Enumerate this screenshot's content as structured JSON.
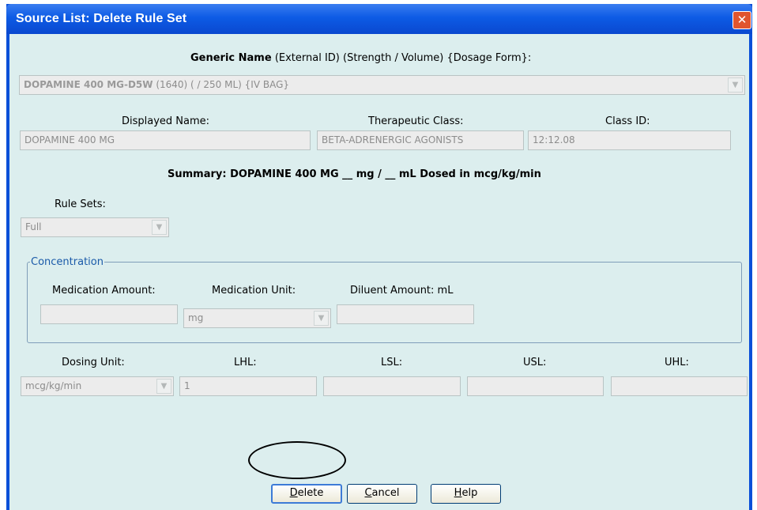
{
  "window": {
    "title": "Source List:  Delete Rule Set",
    "close_glyph": "✕"
  },
  "header": {
    "generic_name_bold": "Generic Name",
    "generic_name_rest": " (External ID) (Strength / Volume) {Dosage Form}:"
  },
  "generic_select": {
    "name": "DOPAMINE 400 MG-D5W",
    "details": " (1640) ( / 250 ML) {IV BAG}"
  },
  "drug_fields": {
    "displayed_name_label": "Displayed Name:",
    "displayed_name_value": "DOPAMINE 400 MG",
    "therapeutic_class_label": "Therapeutic Class:",
    "therapeutic_class_value": "BETA-ADRENERGIC AGONISTS",
    "class_id_label": "Class ID:",
    "class_id_value": "12:12.08"
  },
  "summary": "Summary:  DOPAMINE 400 MG __ mg / __ mL Dosed in mcg/kg/min",
  "rule_sets": {
    "label": "Rule Sets:",
    "selected": "Full"
  },
  "concentration": {
    "group_title": "Concentration",
    "medication_amount_label": "Medication Amount:",
    "medication_amount_value": "",
    "medication_unit_label": "Medication Unit:",
    "medication_unit_selected": "mg",
    "diluent_amount_label": "Diluent Amount: mL",
    "diluent_amount_value": ""
  },
  "limits": {
    "dosing_unit_label": "Dosing Unit:",
    "dosing_unit_selected": "mcg/kg/min",
    "lhl_label": "LHL:",
    "lhl_value": "1",
    "lsl_label": "LSL:",
    "lsl_value": "",
    "usl_label": "USL:",
    "usl_value": "",
    "uhl_label": "UHL:",
    "uhl_value": ""
  },
  "buttons": {
    "delete_mnemonic": "D",
    "delete_rest": "elete",
    "cancel_mnemonic": "C",
    "cancel_rest": "ancel",
    "help_mnemonic": "H",
    "help_rest": "elp"
  },
  "icons": {
    "dropdown": "chevron-down-icon",
    "close": "close-icon"
  },
  "colors": {
    "titlebar": "#0a4fd8",
    "client_background": "#dceeee",
    "close_button": "#e0552f",
    "group_title": "#1a5aa9",
    "disabled_text": "#8c8c8c"
  }
}
